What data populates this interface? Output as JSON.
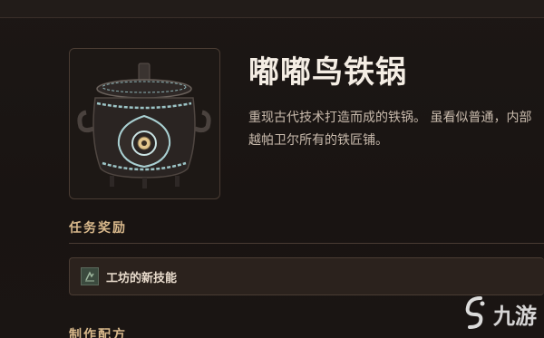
{
  "item": {
    "name": "嘟嘟鸟铁锅",
    "description_lines": [
      "重现古代技术打造而成的铁锅。 虽看似普通，内部",
      "越帕卫尔所有的铁匠铺。"
    ],
    "icon": "iron-pot-icon"
  },
  "rewards": {
    "title": "任务奖励",
    "items": [
      {
        "icon": "skill-book-icon",
        "label": "工坊的新技能"
      }
    ]
  },
  "recipe": {
    "title": "制作配方"
  },
  "watermark": {
    "text": "九游",
    "logo": "jiuyou-logo-icon"
  },
  "colors": {
    "background": "#1a1513",
    "accent": "#d9b98c",
    "title": "#f4ede4",
    "text": "#c9bbad",
    "border": "#4a3c33"
  }
}
